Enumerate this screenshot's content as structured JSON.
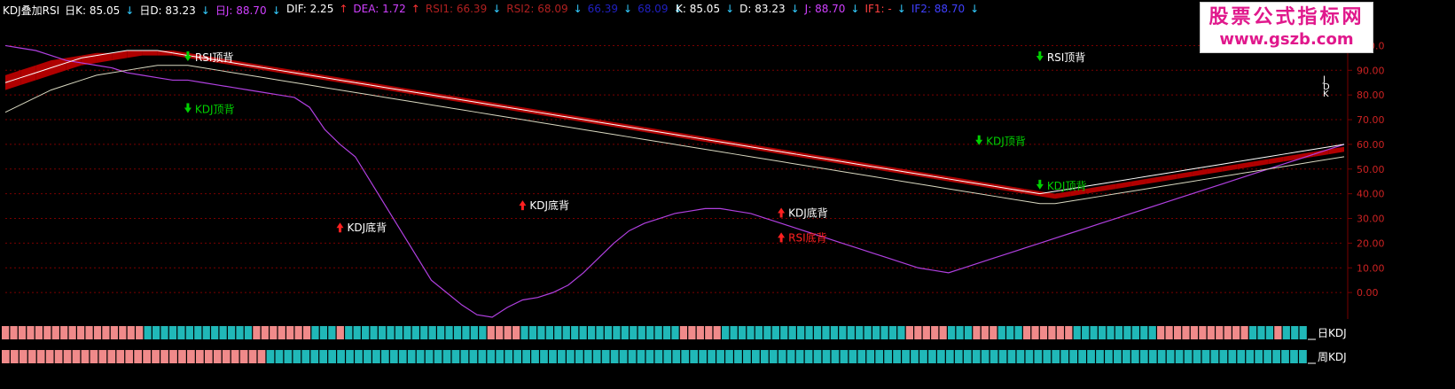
{
  "header": {
    "title": "KDJ叠加RSI",
    "daily_k": "日K: 85.05",
    "daily_d": "日D: 83.23",
    "daily_j": "日J: 88.70",
    "dif": "DIF: 2.25",
    "dea": "DEA: 1.72",
    "rsi1": "RSI1: 66.39",
    "rsi2": "RSI2: 68.09",
    "unk1": "66.39",
    "unk2": "68.09",
    "k": "K: 85.05",
    "d": "D: 83.23",
    "j": "J: 88.70",
    "if1": "IF1: -",
    "if2": "IF2: 88.70"
  },
  "watermark": {
    "line1": "股票公式指标网",
    "line2": "www.gszb.com"
  },
  "colors": {
    "background": "#000000",
    "upper_band": "#b00000",
    "lower_band": "#0000a0",
    "j_line": "#b040e0",
    "rsi_line": "#ff2020",
    "k_line": "#ffffff",
    "d_line": "#d8d8c0",
    "grid": "#7a0000",
    "axis_text": "#cc2222",
    "bar_pink": "#f08a8a",
    "bar_cyan": "#20b8b8",
    "annot_green": "#00d000",
    "annot_red": "#ff2020"
  },
  "chart_data": {
    "type": "line",
    "ylim": [
      -10,
      112
    ],
    "y_ticks": [
      0,
      10,
      20,
      30,
      40,
      50,
      60,
      70,
      80,
      90,
      100
    ],
    "y_tick_labels": [
      "0.00",
      "10.00",
      "20.00",
      "30.00",
      "40.00",
      "50.00",
      "60.00",
      "70.00",
      "80.00",
      "90.00",
      "100.0"
    ],
    "x_count": 89,
    "series": [
      {
        "name": "J",
        "kind": "j",
        "values": [
          100,
          99,
          98,
          96,
          94,
          93,
          92,
          91,
          89,
          88,
          87,
          86,
          86,
          85,
          84,
          83,
          82,
          81,
          80,
          79,
          75,
          66,
          60,
          55,
          45,
          35,
          25,
          15,
          5,
          0,
          -5,
          -9,
          -10,
          -6,
          -3,
          -2,
          0,
          3,
          8,
          14,
          20,
          25,
          28,
          30,
          32,
          33,
          34,
          34,
          33,
          32,
          30,
          28,
          26,
          24,
          22,
          20,
          18,
          16,
          14,
          12,
          10,
          9,
          8,
          10,
          12,
          14,
          16,
          18,
          20,
          22,
          24,
          26,
          28,
          30,
          32,
          34,
          36,
          38,
          40,
          42,
          44,
          46,
          48,
          50,
          52,
          54,
          56,
          58,
          60
        ]
      },
      {
        "name": "K",
        "kind": "k",
        "values": [
          85,
          87,
          89,
          91,
          93,
          95,
          96,
          97,
          98,
          98,
          98,
          97,
          96,
          95,
          94,
          93,
          92,
          91,
          90,
          89,
          88,
          87,
          86,
          85,
          84,
          83,
          82,
          81,
          80,
          79,
          78,
          77,
          76,
          75,
          74,
          73,
          72,
          71,
          70,
          69,
          68,
          67,
          66,
          65,
          64,
          63,
          62,
          61,
          60,
          59,
          58,
          57,
          56,
          55,
          54,
          53,
          52,
          51,
          50,
          49,
          48,
          47,
          46,
          45,
          44,
          43,
          42,
          41,
          40,
          41,
          42,
          43,
          44,
          45,
          46,
          47,
          48,
          49,
          50,
          51,
          52,
          53,
          54,
          55,
          56,
          57,
          58,
          59,
          60
        ]
      },
      {
        "name": "D",
        "kind": "d",
        "values": [
          73,
          76,
          79,
          82,
          84,
          86,
          88,
          89,
          90,
          91,
          92,
          92,
          92,
          91,
          90,
          89,
          88,
          87,
          86,
          85,
          84,
          83,
          82,
          81,
          80,
          79,
          78,
          77,
          76,
          75,
          74,
          73,
          72,
          71,
          70,
          69,
          68,
          67,
          66,
          65,
          64,
          63,
          62,
          61,
          60,
          59,
          58,
          57,
          56,
          55,
          54,
          53,
          52,
          51,
          50,
          49,
          48,
          47,
          46,
          45,
          44,
          43,
          42,
          41,
          40,
          39,
          38,
          37,
          36,
          36,
          37,
          38,
          39,
          40,
          41,
          42,
          43,
          44,
          45,
          46,
          47,
          48,
          49,
          50,
          51,
          52,
          53,
          54,
          55
        ]
      },
      {
        "name": "RSI1",
        "kind": "rsi1",
        "values": [
          88,
          90,
          92,
          94,
          95,
          96,
          97,
          97,
          98,
          98,
          98,
          98,
          97,
          96,
          95,
          94,
          93,
          92,
          91,
          90,
          89,
          88,
          87,
          86,
          85,
          84,
          83,
          82,
          81,
          80,
          79,
          78,
          77,
          76,
          75,
          74,
          73,
          72,
          71,
          70,
          69,
          68,
          67,
          66,
          65,
          64,
          63,
          62,
          61,
          60,
          59,
          58,
          57,
          56,
          55,
          54,
          53,
          52,
          51,
          50,
          49,
          48,
          47,
          46,
          45,
          44,
          43,
          42,
          41,
          40,
          41,
          42,
          43,
          44,
          45,
          46,
          47,
          48,
          49,
          50,
          51,
          52,
          53,
          54,
          55,
          56,
          57,
          58,
          59
        ]
      },
      {
        "name": "RSI2",
        "kind": "rsi2",
        "values": [
          82,
          84,
          86,
          88,
          90,
          92,
          93,
          94,
          95,
          96,
          96,
          96,
          95,
          94,
          93,
          92,
          91,
          90,
          89,
          88,
          87,
          86,
          85,
          84,
          83,
          82,
          81,
          80,
          79,
          78,
          77,
          76,
          75,
          74,
          73,
          72,
          71,
          70,
          69,
          68,
          67,
          66,
          65,
          64,
          63,
          62,
          61,
          60,
          59,
          58,
          57,
          56,
          55,
          54,
          53,
          52,
          51,
          50,
          49,
          48,
          47,
          46,
          45,
          44,
          43,
          42,
          41,
          40,
          39,
          38,
          39,
          40,
          41,
          42,
          43,
          44,
          45,
          46,
          47,
          48,
          49,
          50,
          51,
          52,
          53,
          54,
          55,
          56,
          57
        ]
      },
      {
        "name": "RSI",
        "kind": "rsi",
        "values": [
          null,
          null,
          null,
          null,
          null,
          null,
          null,
          null,
          null,
          null,
          null,
          null,
          null,
          null,
          null,
          null,
          null,
          null,
          null,
          null,
          null,
          null,
          null,
          null,
          null,
          null,
          null,
          null,
          null,
          null,
          null,
          null,
          null,
          null,
          null,
          null,
          null,
          null,
          null,
          null,
          null,
          null,
          null,
          null,
          null,
          null,
          null,
          null,
          null,
          null,
          null,
          null,
          null,
          null,
          null,
          null,
          null,
          null,
          null,
          null,
          null,
          null,
          null,
          null,
          null,
          null,
          null,
          null,
          null,
          null,
          null,
          null,
          null,
          null,
          null,
          null,
          null,
          null,
          null,
          null,
          null,
          null,
          null,
          null,
          null,
          null,
          null,
          null,
          null
        ]
      }
    ],
    "annotations": [
      {
        "label": "RSI顶背",
        "x": 12,
        "y": 93,
        "dir": "down",
        "color": "green",
        "text_color": "white"
      },
      {
        "label": "KDJ顶背",
        "x": 12,
        "y": 72,
        "dir": "down",
        "color": "green",
        "text_color": "green"
      },
      {
        "label": "KDJ底背",
        "x": 22,
        "y": 24,
        "dir": "up",
        "color": "red",
        "text_color": "white"
      },
      {
        "label": "KDJ底背",
        "x": 34,
        "y": 33,
        "dir": "up",
        "color": "red",
        "text_color": "white"
      },
      {
        "label": "KDJ底背",
        "x": 51,
        "y": 30,
        "dir": "up",
        "color": "red",
        "text_color": "white"
      },
      {
        "label": "RSI底背",
        "x": 51,
        "y": 20,
        "dir": "up",
        "color": "red",
        "text_color": "red"
      },
      {
        "label": "KDJ顶背",
        "x": 64,
        "y": 59,
        "dir": "down",
        "color": "green",
        "text_color": "green"
      },
      {
        "label": "RSI顶背",
        "x": 68,
        "y": 93,
        "dir": "down",
        "color": "green",
        "text_color": "white"
      },
      {
        "label": "KDJ顶背",
        "x": 68,
        "y": 41,
        "dir": "down",
        "color": "green",
        "text_color": "green"
      }
    ],
    "end_labels": [
      "J",
      "D",
      "K"
    ],
    "bar_rows": [
      {
        "label": "日KDJ",
        "pattern": "pppppppppppppppppcccccccccccccpppppppcccpcccccccccccccccccppppcccccccccccccccccccpppppccccccccccccccccccccccpppppcccpppcccppppppccccccccccpppppppppppcccpccc"
      },
      {
        "label": "周KDJ",
        "pattern": "ppppppppppppppppppppppppppppppcccccccccccccccccccccccccccccccccccccccccccccccccccccccccccccccccccccccccccccccccccccccccccccccccccccccccccccccccccccc"
      }
    ]
  }
}
